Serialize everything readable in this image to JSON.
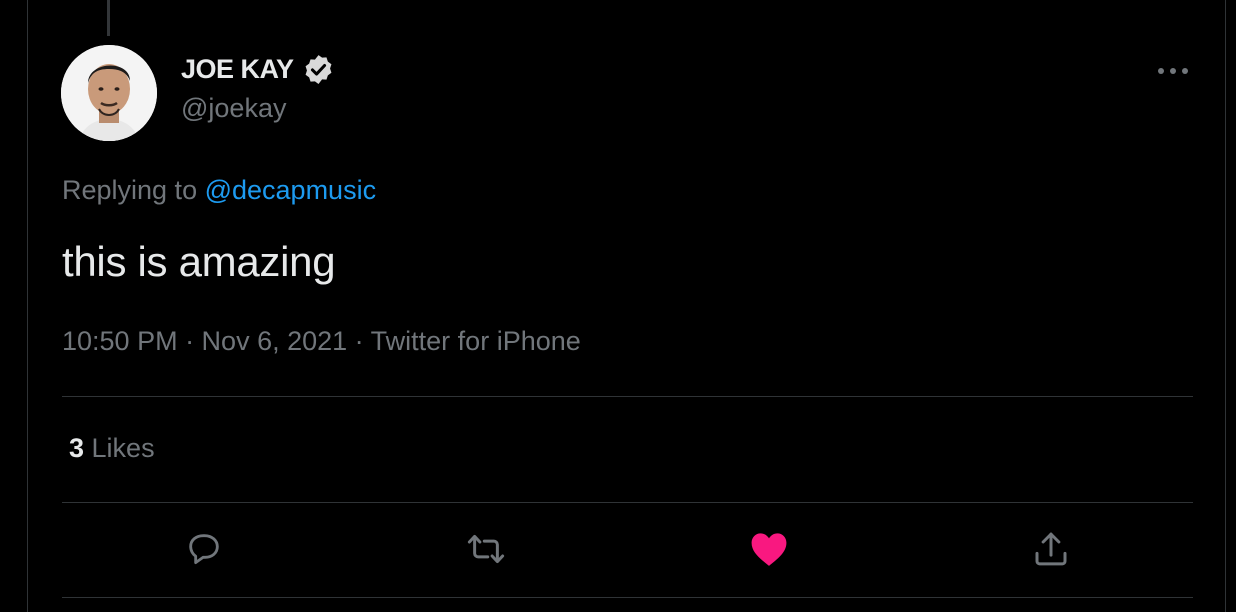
{
  "author": {
    "display_name": "JOE KAY",
    "handle": "@joekay",
    "verified": true,
    "avatar_icon": "user-avatar-photo"
  },
  "reply": {
    "prefix": "Replying to ",
    "mention": "@decapmusic"
  },
  "tweet": {
    "text": "this is amazing",
    "meta": "10:50 PM · Nov 6, 2021 · Twitter for iPhone"
  },
  "stats": {
    "likes_count": "3",
    "likes_label": " Likes"
  },
  "actions": [
    {
      "name": "reply",
      "icon": "speech-bubble-icon"
    },
    {
      "name": "retweet",
      "icon": "retweet-arrows-icon"
    },
    {
      "name": "like",
      "icon": "heart-icon",
      "liked": true
    },
    {
      "name": "share",
      "icon": "share-upload-icon"
    }
  ],
  "colors": {
    "background": "#000000",
    "text_primary": "#e7e9ea",
    "text_secondary": "#71767b",
    "link": "#1d9bf0",
    "like_active": "#f91880",
    "divider": "#2f3336"
  }
}
